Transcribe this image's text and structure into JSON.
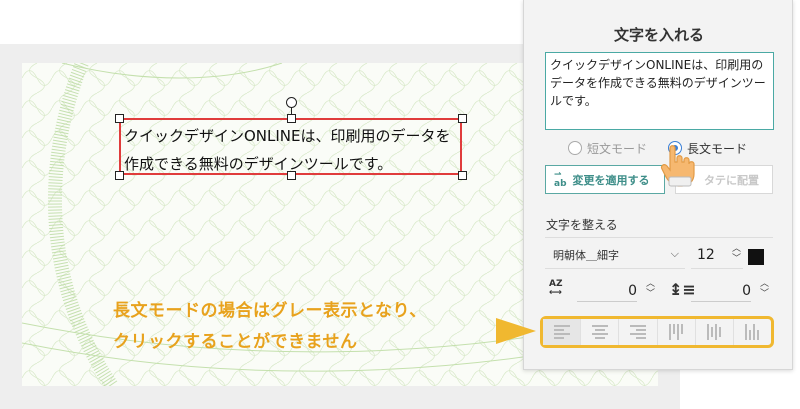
{
  "canvas": {
    "selected_text": "クイックデザインONLINEは、印刷用のデータを\n作成できる無料のデザインツールです。"
  },
  "panel": {
    "title": "文字を入れる",
    "textbox_value": "クイックデザインONLINEは、印刷用のデータを作成できる無料のデザインツールです。",
    "radio_short": "短文モード",
    "radio_long": "長文モード",
    "mode_selected": "長文モード",
    "apply_button": "変更を適用する",
    "apply_icon": "ab",
    "vertical_button": "タテに配置",
    "section_label": "文字を整える",
    "font_family": "明朝体＿細字",
    "font_size": "12",
    "text_color": "#111111",
    "letter_spacing_icon": "AZ",
    "letter_spacing": "0",
    "line_spacing": "0",
    "alignment_buttons": [
      "align-left",
      "align-center",
      "align-right",
      "vertical-top",
      "vertical-center",
      "vertical-bottom"
    ],
    "selected_alignment": "align-left"
  },
  "annotation": {
    "text": "長文モードの場合はグレー表示となり、\nクリックすることができません",
    "color": "#e8a21d",
    "highlight_color": "#f0b830"
  }
}
